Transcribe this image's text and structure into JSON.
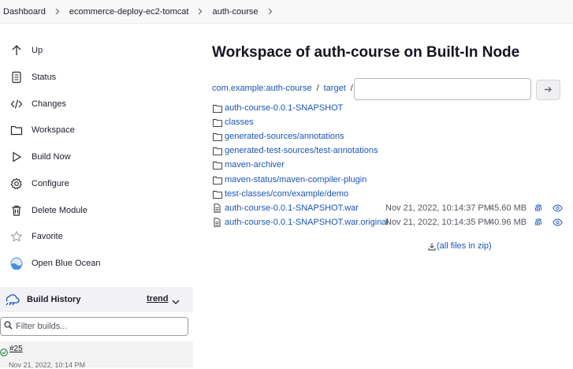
{
  "breadcrumbs": [
    "Dashboard",
    "ecommerce-deploy-ec2-tomcat",
    "auth-course"
  ],
  "sidebar": {
    "tasks": [
      {
        "label": "Up",
        "icon": "arrow-up-icon"
      },
      {
        "label": "Status",
        "icon": "document-icon"
      },
      {
        "label": "Changes",
        "icon": "code-icon"
      },
      {
        "label": "Workspace",
        "icon": "folder-icon"
      },
      {
        "label": "Build Now",
        "icon": "play-icon"
      },
      {
        "label": "Configure",
        "icon": "gear-icon"
      },
      {
        "label": "Delete Module",
        "icon": "trash-icon"
      },
      {
        "label": "Favorite",
        "icon": "star-icon"
      },
      {
        "label": "Open Blue Ocean",
        "icon": "blue-ocean-icon"
      }
    ],
    "build_history": {
      "title": "Build History",
      "trend_label": "trend",
      "filter_placeholder": "Filter builds...",
      "builds": [
        {
          "number": "#25",
          "date": "Nov 21, 2022, 10:14 PM",
          "status": "success"
        }
      ]
    }
  },
  "main": {
    "title": "Workspace of auth-course on Built-In Node",
    "path": [
      "com.example:auth-course",
      "target"
    ],
    "path_separator": "/",
    "folders": [
      "auth-course-0.0.1-SNAPSHOT",
      "classes",
      "generated-sources/annotations",
      "generated-test-sources/test-annotations",
      "maven-archiver",
      "maven-status/maven-compiler-plugin",
      "test-classes/com/example/demo"
    ],
    "files": [
      {
        "name": "auth-course-0.0.1-SNAPSHOT.war",
        "date": "Nov 21, 2022, 10:14:37 PM",
        "size": "45.60 MB"
      },
      {
        "name": "auth-course-0.0.1-SNAPSHOT.war.original",
        "date": "Nov 21, 2022, 10:14:35 PM",
        "size": "40.96 MB"
      }
    ],
    "zip_label": "(all files in zip)"
  },
  "colors": {
    "link": "#1a55b5",
    "success": "#138347",
    "text": "#14141f"
  }
}
